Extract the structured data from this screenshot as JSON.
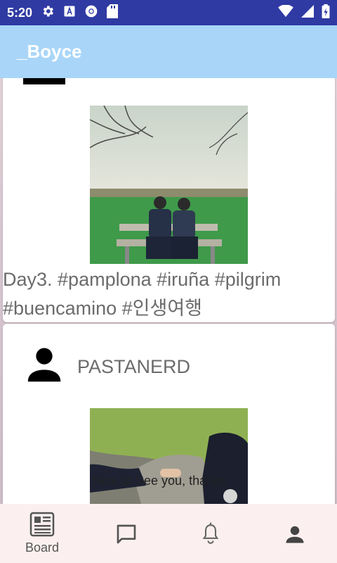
{
  "status_bar": {
    "time": "5:20"
  },
  "app_bar": {
    "title": "_Boyce"
  },
  "feed": {
    "posts": [
      {
        "caption": "Day3. #pamplona #iruña #pilgrim #buencamino #인생여행"
      },
      {
        "username": "PASTANERD",
        "photo_text": "Nice to See you, thanks"
      }
    ]
  },
  "bottom_nav": {
    "items": [
      {
        "label": "Board",
        "icon": "newspaper-icon"
      },
      {
        "icon": "chat-icon"
      },
      {
        "icon": "bell-icon"
      },
      {
        "icon": "person-icon"
      }
    ]
  },
  "colors": {
    "status_bar": "#2f3aa3",
    "app_bar": "#a9d6f8",
    "bottom_nav": "#fbf0ef",
    "text_gray": "#6b6b6b"
  }
}
